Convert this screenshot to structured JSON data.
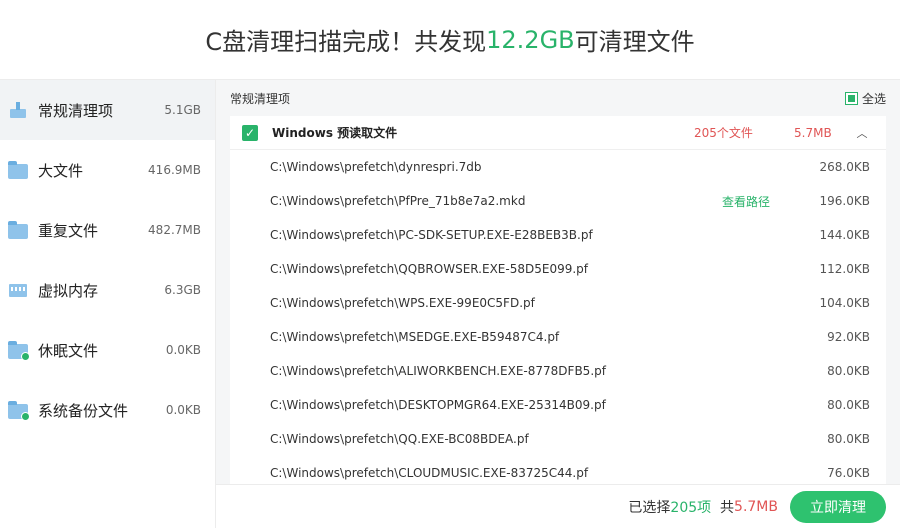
{
  "header": {
    "title_prefix": "C盘清理扫描完成！共发现",
    "total_size": "12.2GB",
    "title_suffix": "可清理文件"
  },
  "sidebar": {
    "items": [
      {
        "label": "常规清理项",
        "size": "5.1GB",
        "icon": "broom-icon"
      },
      {
        "label": "大文件",
        "size": "416.9MB",
        "icon": "folder-icon"
      },
      {
        "label": "重复文件",
        "size": "482.7MB",
        "icon": "folder-icon"
      },
      {
        "label": "虚拟内存",
        "size": "6.3GB",
        "icon": "memory-icon"
      },
      {
        "label": "休眠文件",
        "size": "0.0KB",
        "icon": "folder-icon"
      },
      {
        "label": "系统备份文件",
        "size": "0.0KB",
        "icon": "folder-icon"
      }
    ]
  },
  "main": {
    "section_title": "常规清理项",
    "select_all": "全选",
    "group": {
      "title": "Windows 预读取文件",
      "count": "205个文件",
      "size": "5.7MB"
    },
    "view_path": "查看路径",
    "files": [
      {
        "path": "C:\\Windows\\prefetch\\dynrespri.7db",
        "size": "268.0KB"
      },
      {
        "path": "C:\\Windows\\prefetch\\PfPre_71b8e7a2.mkd",
        "size": "196.0KB"
      },
      {
        "path": "C:\\Windows\\prefetch\\PC-SDK-SETUP.EXE-E28BEB3B.pf",
        "size": "144.0KB"
      },
      {
        "path": "C:\\Windows\\prefetch\\QQBROWSER.EXE-58D5E099.pf",
        "size": "112.0KB"
      },
      {
        "path": "C:\\Windows\\prefetch\\WPS.EXE-99E0C5FD.pf",
        "size": "104.0KB"
      },
      {
        "path": "C:\\Windows\\prefetch\\MSEDGE.EXE-B59487C4.pf",
        "size": "92.0KB"
      },
      {
        "path": "C:\\Windows\\prefetch\\ALIWORKBENCH.EXE-8778DFB5.pf",
        "size": "80.0KB"
      },
      {
        "path": "C:\\Windows\\prefetch\\DESKTOPMGR64.EXE-25314B09.pf",
        "size": "80.0KB"
      },
      {
        "path": "C:\\Windows\\prefetch\\QQ.EXE-BC08BDEA.pf",
        "size": "80.0KB"
      },
      {
        "path": "C:\\Windows\\prefetch\\CLOUDMUSIC.EXE-83725C44.pf",
        "size": "76.0KB"
      }
    ]
  },
  "footer": {
    "selected_prefix": "已选择",
    "selected_count": "205项",
    "total_prefix": "共",
    "total_size": "5.7MB",
    "clean_button": "立即清理"
  },
  "colors": {
    "accent": "#29b36a",
    "danger": "#e05555"
  }
}
